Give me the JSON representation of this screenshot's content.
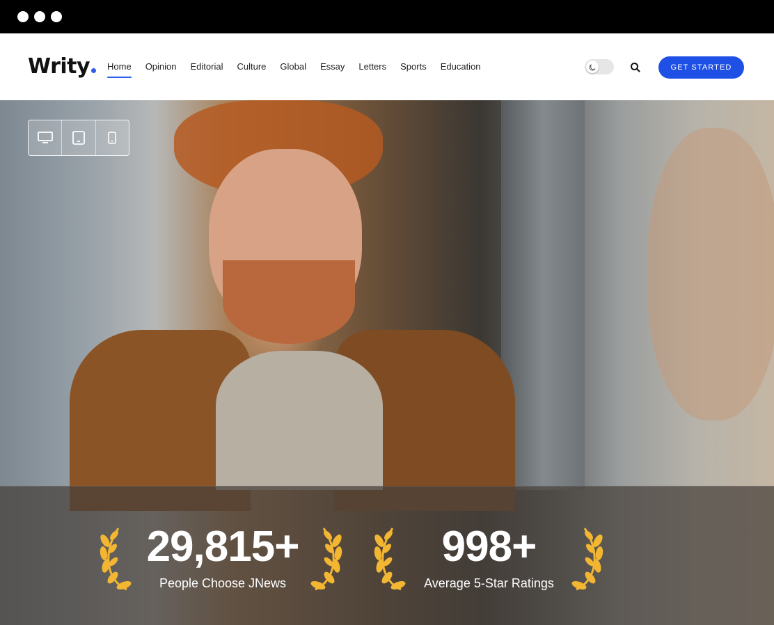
{
  "window": {
    "controls": [
      "close",
      "minimize",
      "maximize"
    ]
  },
  "header": {
    "logo_text": "Writy",
    "logo_dot_color": "#2f5de8",
    "nav": [
      {
        "label": "Home",
        "active": true
      },
      {
        "label": "Opinion",
        "active": false
      },
      {
        "label": "Editorial",
        "active": false
      },
      {
        "label": "Culture",
        "active": false
      },
      {
        "label": "Global",
        "active": false
      },
      {
        "label": "Essay",
        "active": false
      },
      {
        "label": "Letters",
        "active": false
      },
      {
        "label": "Sports",
        "active": false
      },
      {
        "label": "Education",
        "active": false
      }
    ],
    "dark_mode_toggle": {
      "icon": "moon-icon",
      "enabled": false
    },
    "search_icon": "search-icon",
    "cta_label": "GET STARTED",
    "cta_color": "#1f50e6"
  },
  "device_switcher": {
    "options": [
      "desktop-icon",
      "tablet-icon",
      "mobile-icon"
    ]
  },
  "stats": [
    {
      "value": "29,815+",
      "label": "People Choose JNews",
      "icon": "laurel-icon"
    },
    {
      "value": "998+",
      "label": "Average 5-Star Ratings",
      "icon": "laurel-icon"
    }
  ],
  "accent_colors": {
    "laurel": "#f2b632"
  }
}
